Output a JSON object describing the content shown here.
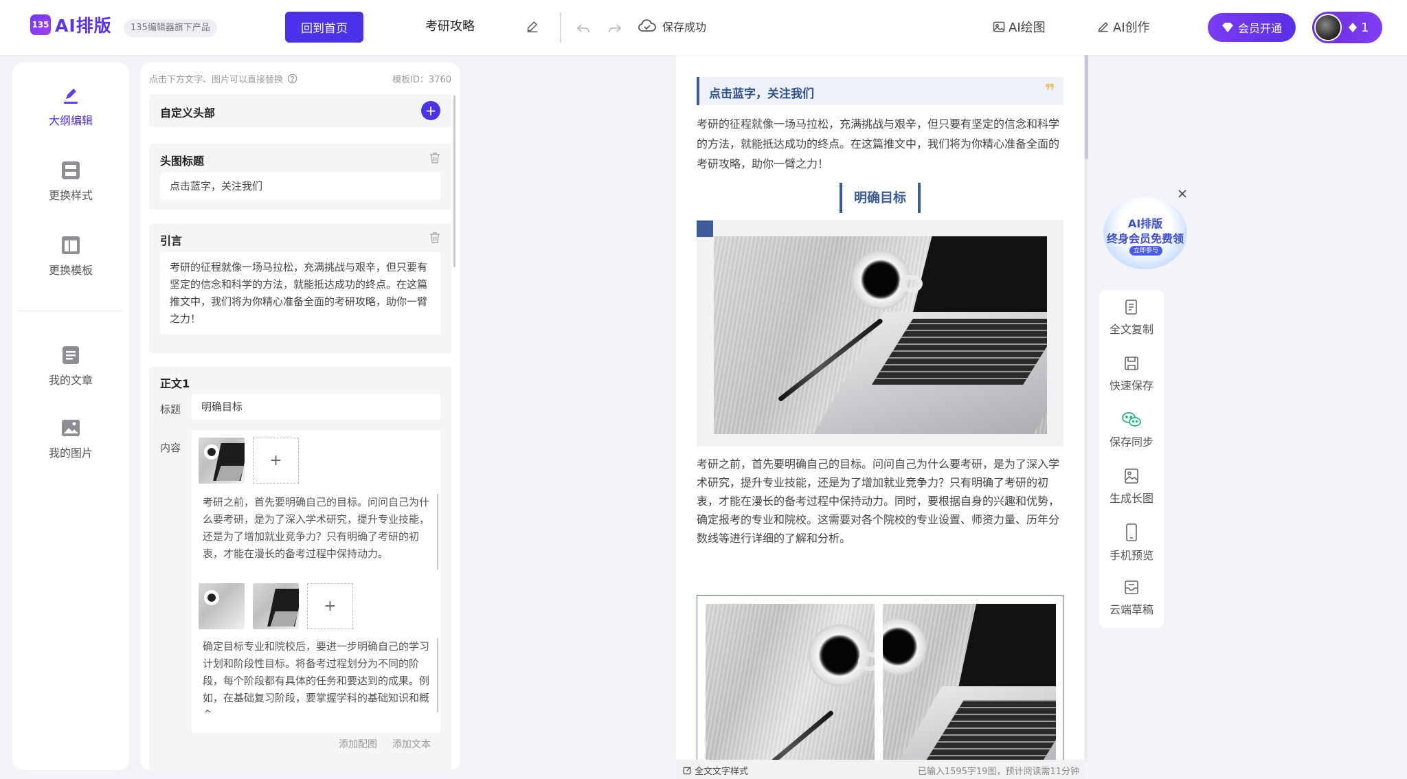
{
  "app": {
    "logo_mark": "135",
    "logo_text": "AI排版",
    "logo_sub": "135编辑器旗下产品"
  },
  "topbar": {
    "home_button": "回到首页",
    "doc_title": "考研攻略",
    "save_status": "保存成功",
    "ai_draw": "AI绘图",
    "ai_create": "AI创作",
    "vip_button": "会员开通",
    "diamond_count": "1"
  },
  "leftnav": {
    "items": [
      {
        "label": "大纲编辑",
        "icon": "pen-edit-icon",
        "active": true
      },
      {
        "label": "更换样式",
        "icon": "layout-style-icon",
        "active": false
      },
      {
        "label": "更换模板",
        "icon": "template-icon",
        "active": false
      },
      {
        "label": "我的文章",
        "icon": "article-icon",
        "active": false
      },
      {
        "label": "我的图片",
        "icon": "image-icon",
        "active": false
      }
    ]
  },
  "editor": {
    "hint": "点击下方文字、图片可以直接替换",
    "template_id": "模板ID：3760",
    "custom_header": "自定义头部",
    "head_title_label": "头图标题",
    "head_title_value": "点击蓝字，关注我们",
    "quote_label": "引言",
    "quote_text": "考研的征程就像一场马拉松，充满挑战与艰辛，但只要有坚定的信念和科学的方法，就能抵达成功的终点。在这篇推文中，我们将为你精心准备全面的考研攻略，助你一臂之力！",
    "body1_label": "正文1",
    "title_label": "标题",
    "title_value": "明确目标",
    "content_label": "内容",
    "add_symbol": "+",
    "para1": "考研之前，首先要明确自己的目标。问问自己为什么要考研，是为了深入学术研究，提升专业技能，还是为了增加就业竞争力？只有明确了考研的初衷，才能在漫长的备考过程中保持动力。",
    "para2": "确定目标专业和院校后，要进一步明确自己的学习计划和阶段性目标。将备考过程划分为不同的阶段，每个阶段都有具体的任务和要达到的成果。例如，在基础复习阶段，要掌握学科的基础知识和概念。",
    "add_image": "添加配图",
    "add_text": "添加文本"
  },
  "preview": {
    "header": "点击蓝字，关注我们",
    "quote_mark": "❞",
    "intro": "考研的征程就像一场马拉松，充满挑战与艰辛，但只要有坚定的信念和科学的方法，就能抵达成功的终点。在这篇推文中，我们将为你精心准备全面的考研攻略，助你一臂之力！",
    "section_title": "明确目标",
    "body": "考研之前，首先要明确自己的目标。问问自己为什么要考研，是为了深入学术研究，提升专业技能，还是为了增加就业竞争力？只有明确了考研的初衷，才能在漫长的备考过程中保持动力。同时，要根据自身的兴趣和优势，确定报考的专业和院校。这需要对各个院校的专业设置、师资力量、历年分数线等进行详细的了解和分析。",
    "status_left": "全文文字样式",
    "status_right": "已输入1595字19图，预计阅读需11分钟"
  },
  "promo": {
    "line1": "AI排版",
    "line2": "终身会员免费领",
    "button": "立即参与"
  },
  "tools": {
    "items": [
      {
        "label": "全文复制",
        "icon": "copy-doc-icon"
      },
      {
        "label": "快速保存",
        "icon": "save-icon"
      },
      {
        "label": "保存同步",
        "icon": "wechat-icon"
      },
      {
        "label": "生成长图",
        "icon": "long-image-icon"
      },
      {
        "label": "手机预览",
        "icon": "phone-icon"
      },
      {
        "label": "云端草稿",
        "icon": "cloud-draft-icon"
      }
    ]
  },
  "colors": {
    "brand": "#4a32e8",
    "preview_accent": "#3b5b9b",
    "quote_gold": "#e8c070"
  }
}
